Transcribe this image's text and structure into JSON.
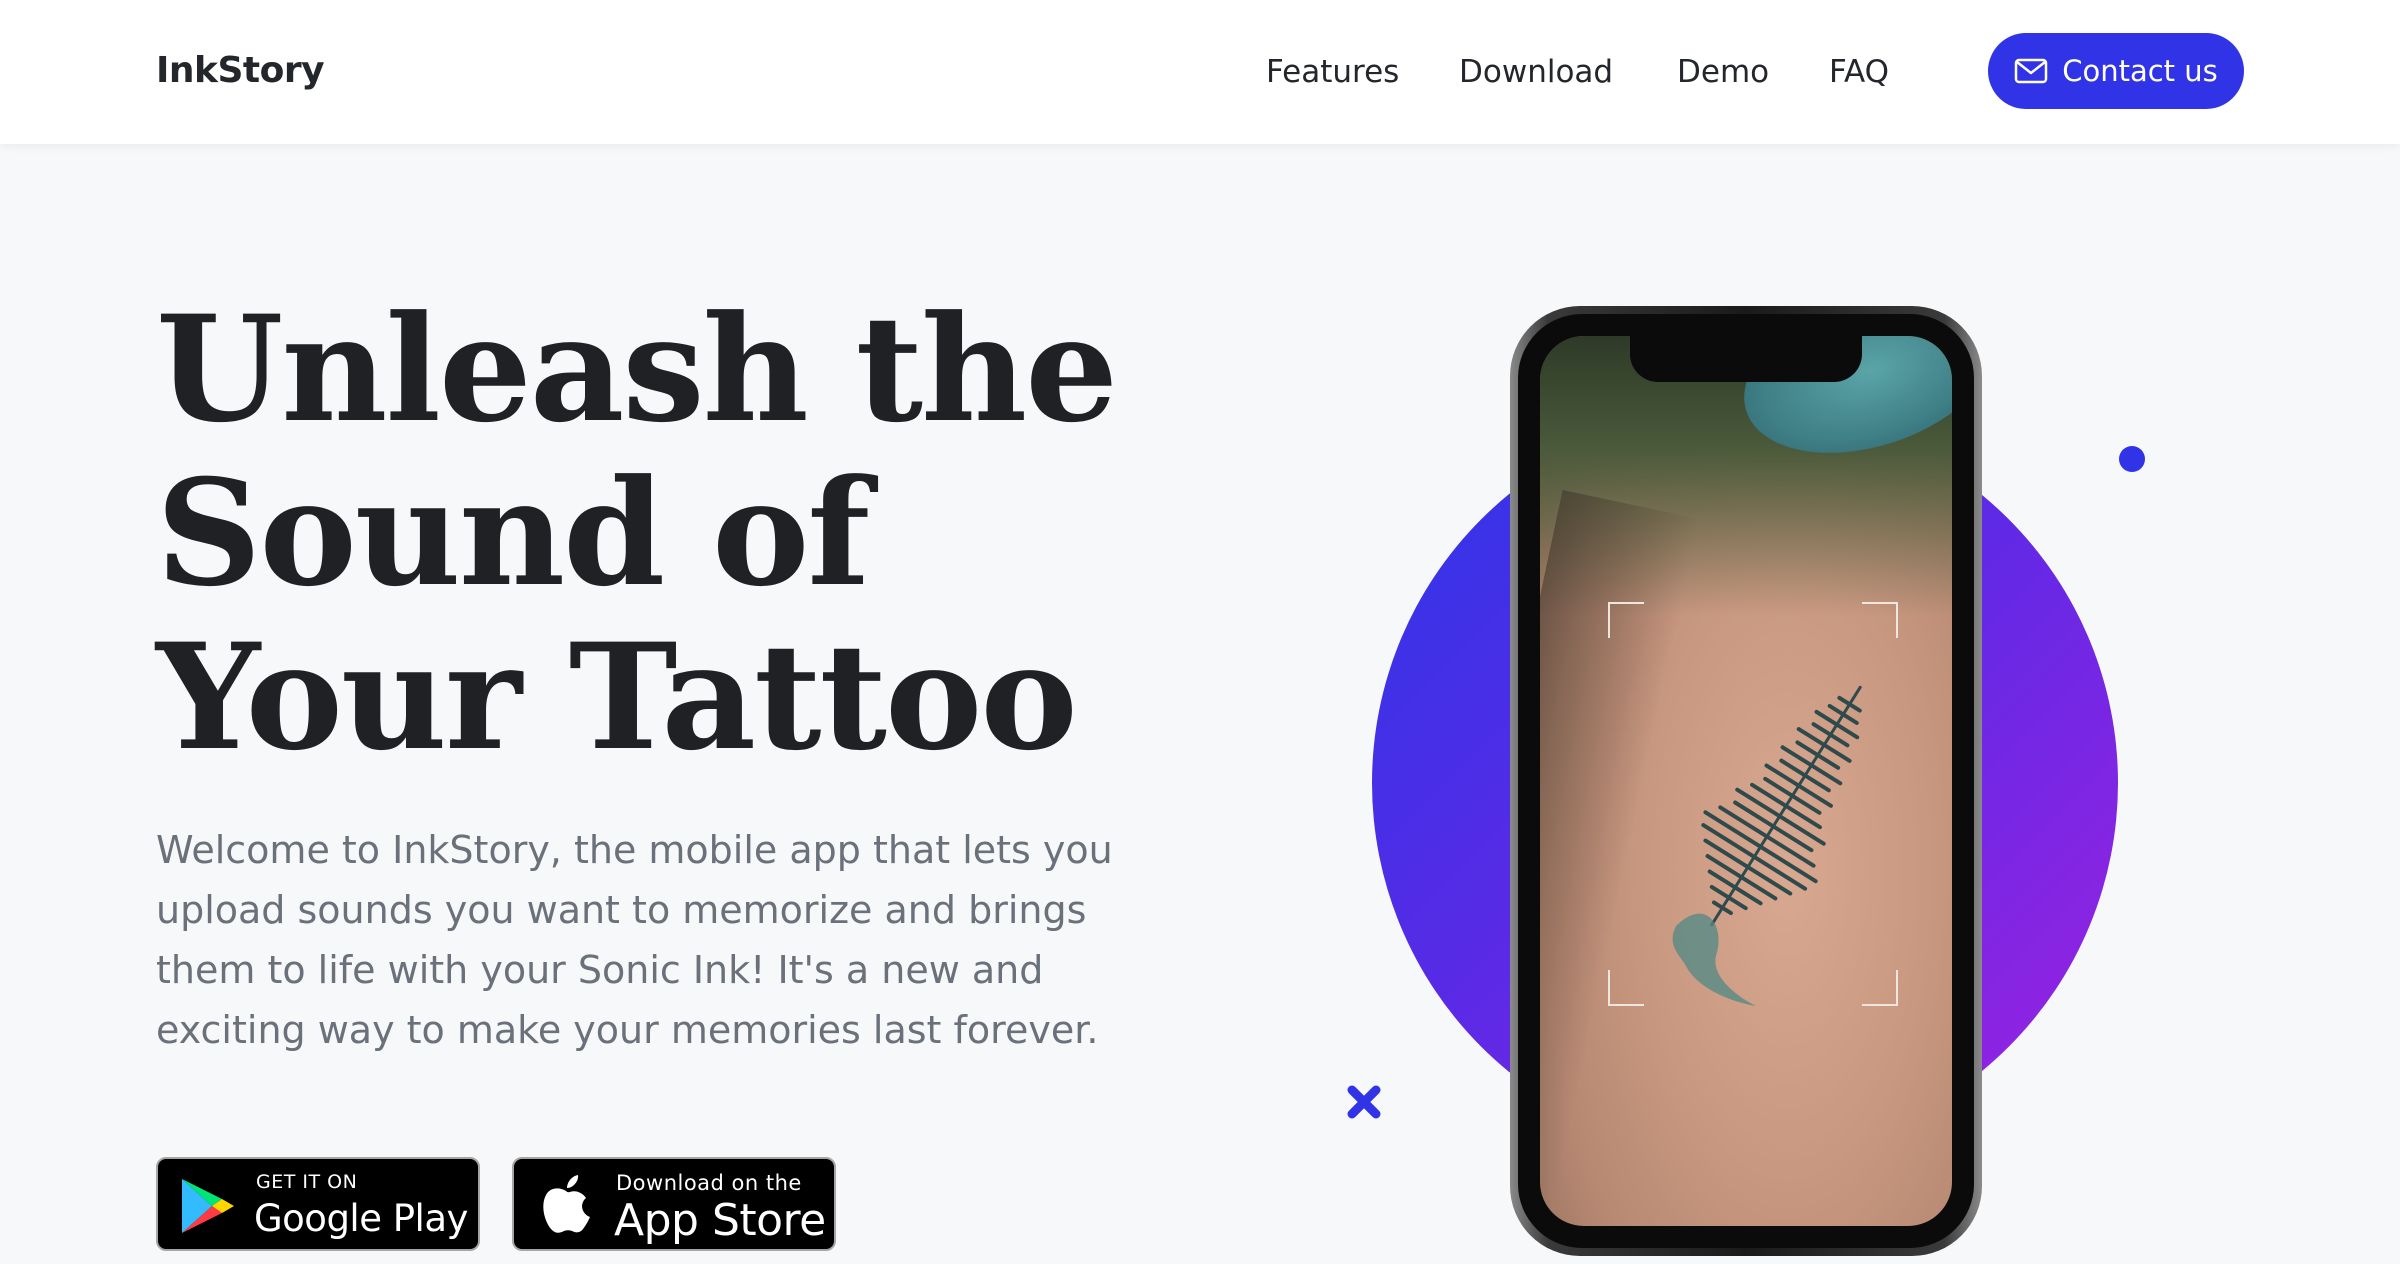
{
  "brand": "InkStory",
  "nav": {
    "links": [
      "Features",
      "Download",
      "Demo",
      "FAQ"
    ],
    "contact_label": "Contact us"
  },
  "hero": {
    "title_lines": [
      "Unleash the",
      "Sound of",
      "Your Tattoo"
    ],
    "description": "Welcome to InkStory, the mobile app that lets you upload sounds you want to memorize and brings them to life with your Sonic Ink! It's a new and exciting way to make your memories last forever."
  },
  "badges": {
    "google_play": {
      "small": "GET IT ON",
      "big": "Google Play"
    },
    "app_store": {
      "small": "Download on the",
      "big": "App Store"
    }
  },
  "colors": {
    "accent": "#3034e6",
    "gradient_start": "#2c36e8",
    "gradient_end": "#9e22e0",
    "text_dark": "#1f2125",
    "text_muted": "#6b717a"
  },
  "icons": {
    "contact": "envelope-icon",
    "google_play": "google-play-icon",
    "app_store": "apple-icon"
  }
}
